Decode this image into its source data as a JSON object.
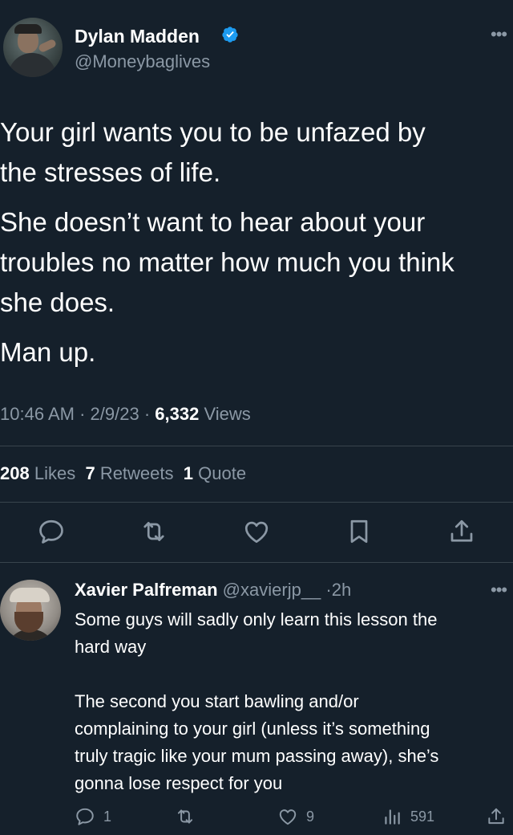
{
  "tweet": {
    "author_name": "Dylan Madden",
    "author_handle": "@Moneybaglives",
    "verified": true,
    "paragraphs": [
      "Your girl wants you to be unfazed by\nthe stresses of life.",
      "She doesn’t want to hear about your\ntroubles no matter how much you think\nshe does.",
      "Man up."
    ],
    "time": "10:46 AM",
    "date": "2/9/23",
    "views_count": "6,332",
    "views_label": "Views",
    "likes_count": "208",
    "likes_label": "Likes",
    "retweets_count": "7",
    "retweets_label": "Retweets",
    "quotes_count": "1",
    "quotes_label": "Quote"
  },
  "actions": [
    "reply-icon",
    "retweet-icon",
    "like-icon",
    "bookmark-icon",
    "share-icon"
  ],
  "reply": {
    "author_name": "Xavier Palfreman",
    "author_handle": "@xavierjp__",
    "age": "2h",
    "text": "Some guys will sadly only learn this lesson the\nhard way\n\nThe second you start bawling and/or\ncomplaining to your girl (unless it’s something\ntruly tragic like your mum passing away), she’s\ngonna lose respect for you",
    "reply_count": "1",
    "retweet_count": "",
    "like_count": "9",
    "views_count": "591"
  },
  "colors": {
    "background": "#15202b",
    "secondary_text": "#8b98a5",
    "verified_blue": "#1d9bf0",
    "divider": "#38444d"
  },
  "separator": "·",
  "more_glyph": "•••"
}
